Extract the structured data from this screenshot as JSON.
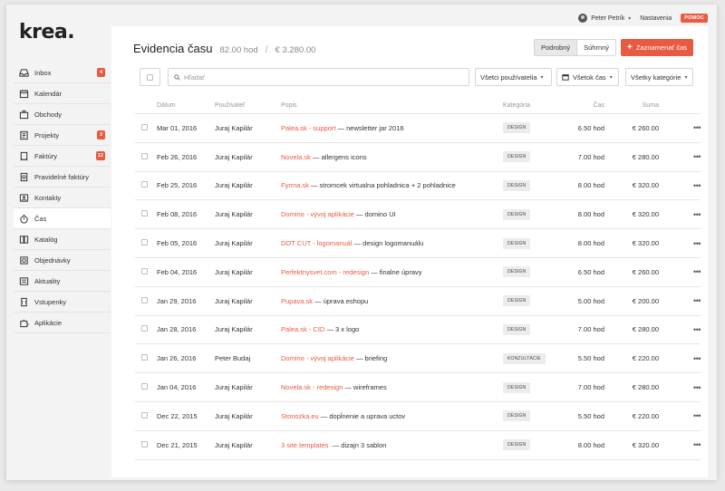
{
  "brand": {
    "logo": "krea."
  },
  "topbar": {
    "user_name": "Peter Petrík",
    "settings_label": "Nastavenia",
    "help_label": "POMOC"
  },
  "sidebar": {
    "items": [
      {
        "label": "Inbox",
        "icon": "inbox-icon",
        "badge": "4"
      },
      {
        "label": "Kalendár",
        "icon": "calendar-icon",
        "badge": ""
      },
      {
        "label": "Obchody",
        "icon": "briefcase-icon",
        "badge": ""
      },
      {
        "label": "Projekty",
        "icon": "projects-icon",
        "badge": "3"
      },
      {
        "label": "Faktúry",
        "icon": "invoice-icon",
        "badge": "12"
      },
      {
        "label": "Pravidelné faktúry",
        "icon": "recurring-invoice-icon",
        "badge": ""
      },
      {
        "label": "Kontakty",
        "icon": "contacts-icon",
        "badge": ""
      },
      {
        "label": "Čas",
        "icon": "stopwatch-icon",
        "badge": "",
        "active": true
      },
      {
        "label": "Katalóg",
        "icon": "catalog-icon",
        "badge": ""
      },
      {
        "label": "Objednávky",
        "icon": "orders-icon",
        "badge": ""
      },
      {
        "label": "Aktuality",
        "icon": "news-icon",
        "badge": ""
      },
      {
        "label": "Vstupenky",
        "icon": "ticket-icon",
        "badge": ""
      },
      {
        "label": "Aplikácie",
        "icon": "puzzle-icon",
        "badge": ""
      }
    ]
  },
  "header": {
    "title": "Evidencia času",
    "hours": "82.00 hod",
    "separator": "/",
    "amount": "€ 3.280.00",
    "view_detailed": "Podrobný",
    "view_summary": "Súhrnný",
    "cta_label": "Zaznamenať čas"
  },
  "filters": {
    "search_placeholder": "Hľadať",
    "users": "Všetci používatelia",
    "time": "Všetok čas",
    "categories": "Všetky kategórie"
  },
  "table": {
    "headers": {
      "date": "Dátum",
      "user": "Používateľ",
      "desc": "Popis",
      "cat": "Kategória",
      "time": "Čas",
      "sum": "Suma"
    },
    "rows": [
      {
        "date": "Mar 01, 2016",
        "user": "Juraj Kapilár",
        "link": "Palea.sk - support",
        "rest": " — newsletter jar 2016",
        "cat": "DESIGN",
        "time": "6.50 hod",
        "sum": "€ 260.00"
      },
      {
        "date": "Feb 26, 2016",
        "user": "Juraj Kapilár",
        "link": "Novela.sk",
        "rest": " — allergens icons",
        "cat": "DESIGN",
        "time": "7.00 hod",
        "sum": "€ 280.00"
      },
      {
        "date": "Feb 25, 2016",
        "user": "Juraj Kapilár",
        "link": "Fyrma.sk",
        "rest": " — stromcek virtualna pohladnica + 2 pohladnice",
        "cat": "DESIGN",
        "time": "8.00 hod",
        "sum": "€ 320.00"
      },
      {
        "date": "Feb 08, 2016",
        "user": "Juraj Kapilár",
        "link": "Domino - vývoj aplikácie",
        "rest": " — domino UI",
        "cat": "DESIGN",
        "time": "8.00 hod",
        "sum": "€ 320.00"
      },
      {
        "date": "Feb 05, 2016",
        "user": "Juraj Kapilár",
        "link": "DOT CUT - logomanuál",
        "rest": " — design logomanuálu",
        "cat": "DESIGN",
        "time": "8.00 hod",
        "sum": "€ 320.00"
      },
      {
        "date": "Feb 04, 2016",
        "user": "Juraj Kapilár",
        "link": "Perfektnysvet.com - redesign",
        "rest": " — finalne úpravy",
        "cat": "DESIGN",
        "time": "6.50 hod",
        "sum": "€ 260.00"
      },
      {
        "date": "Jan 29, 2016",
        "user": "Juraj Kapilár",
        "link": "Pupava.sk",
        "rest": " — úprava eshopu",
        "cat": "DESIGN",
        "time": "5.00 hod",
        "sum": "€ 200.00"
      },
      {
        "date": "Jan 28, 2016",
        "user": "Juraj Kapilár",
        "link": "Palea.sk - CID",
        "rest": " — 3 x logo",
        "cat": "DESIGN",
        "time": "7.00 hod",
        "sum": "€ 280.00"
      },
      {
        "date": "Jan 26, 2016",
        "user": "Peter Budaj",
        "link": "Domino - vývoj aplikácie",
        "rest": " — briefing",
        "cat": "KONZULTÁCIE",
        "time": "5.50 hod",
        "sum": "€ 220.00"
      },
      {
        "date": "Jan 04, 2016",
        "user": "Juraj Kapilár",
        "link": "Novela.sk - redesign",
        "rest": " — wireframes",
        "cat": "DESIGN",
        "time": "7.00 hod",
        "sum": "€ 280.00"
      },
      {
        "date": "Dec 22, 2015",
        "user": "Juraj Kapilár",
        "link": "Stonozka.eu",
        "rest": " — dopĺnenie a uprava uctov",
        "cat": "DESIGN",
        "time": "5.50 hod",
        "sum": "€ 220.00"
      },
      {
        "date": "Dec 21, 2015",
        "user": "Juraj Kapilár",
        "link": "3 site templates",
        "rest": "  — dizajn 3 sablon",
        "cat": "DESIGN",
        "time": "8.00 hod",
        "sum": "€ 320.00"
      }
    ]
  },
  "colors": {
    "accent": "#e85a42",
    "badge_bg": "#ececee"
  }
}
